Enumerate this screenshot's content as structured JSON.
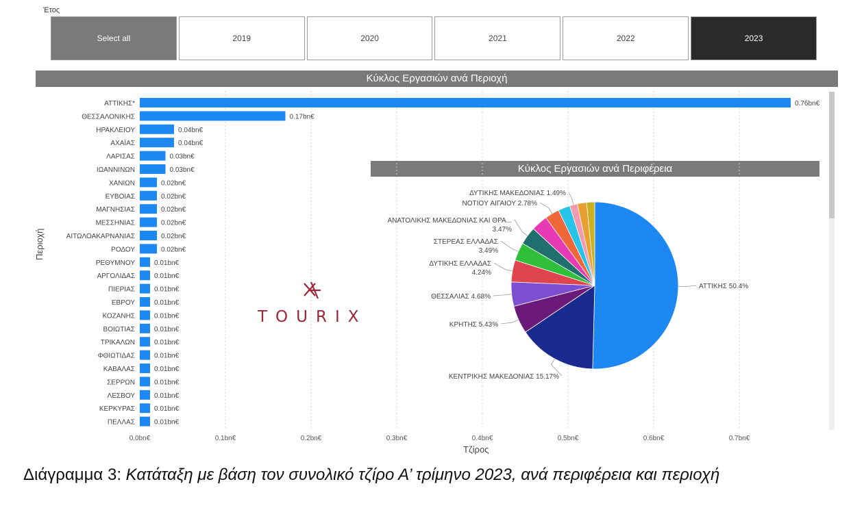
{
  "slicer": {
    "label": "Έτος",
    "buttons": [
      "Select all",
      "2019",
      "2020",
      "2021",
      "2022",
      "2023"
    ],
    "selected": "2023"
  },
  "logo": {
    "text": "TOURIX",
    "color": "#9b2738"
  },
  "caption": {
    "prefix": "Διάγραμμα 3: ",
    "text": "Κατάταξη με βάση τον συνολικό τζίρο Α’ τρίμηνο 2023, ανά περιφέρεια και περιοχή"
  },
  "chart_data": [
    {
      "type": "bar",
      "orientation": "horizontal",
      "title": "Κύκλος Εργασιών ανά Περιοχή",
      "xlabel": "Τζίρος",
      "ylabel": "Περιοχή",
      "xlim": [
        0,
        0.75
      ],
      "grid": true,
      "color": "#1e88f2",
      "xticks": [
        "0.0bn€",
        "0.1bn€",
        "0.2bn€",
        "0.3bn€",
        "0.4bn€",
        "0.5bn€",
        "0.6bn€",
        "0.7bn€"
      ],
      "xtick_values": [
        0,
        0.1,
        0.2,
        0.3,
        0.4,
        0.5,
        0.6,
        0.7
      ],
      "categories": [
        "ΑΤΤΙΚΗΣ*",
        "ΘΕΣΣΑΛΟΝΙΚΗΣ",
        "ΗΡΑΚΛΕΙΟΥ",
        "ΑΧΑΪΑΣ",
        "ΛΑΡΙΣΑΣ",
        "ΙΩΑΝΝΙΝΩΝ",
        "ΧΑΝΙΩΝ",
        "ΕΥΒΟΙΑΣ",
        "ΜΑΓΝΗΣΙΑΣ",
        "ΜΕΣΣΗΝΙΑΣ",
        "ΑΙΤΩΛΟΑΚΑΡΝΑΝΙΑΣ",
        "ΡΟΔΟΥ",
        "ΡΕΘΥΜΝΟΥ",
        "ΑΡΓΟΛΙΔΑΣ",
        "ΠΙΕΡΙΑΣ",
        "ΕΒΡΟΥ",
        "ΚΟΖΑΝΗΣ",
        "ΒΟΙΩΤΙΑΣ",
        "ΤΡΙΚΑΛΩΝ",
        "ΦΘΙΩΤΙΔΑΣ",
        "ΚΑΒΑΛΑΣ",
        "ΣΕΡΡΩΝ",
        "ΛΕΣΒΟΥ",
        "ΚΕΡΚΥΡΑΣ",
        "ΠΕΛΛΑΣ"
      ],
      "values": [
        0.76,
        0.17,
        0.04,
        0.04,
        0.03,
        0.03,
        0.02,
        0.02,
        0.02,
        0.02,
        0.02,
        0.02,
        0.01,
        0.01,
        0.01,
        0.01,
        0.01,
        0.01,
        0.01,
        0.01,
        0.01,
        0.01,
        0.01,
        0.01,
        0.01
      ],
      "data_labels": [
        "0.76bn€",
        "0.17bn€",
        "0.04bn€",
        "0.04bn€",
        "0.03bn€",
        "0.03bn€",
        "0.02bn€",
        "0.02bn€",
        "0.02bn€",
        "0.02bn€",
        "0.02bn€",
        "0.02bn€",
        "0.01bn€",
        "0.01bn€",
        "0.01bn€",
        "0.01bn€",
        "0.01bn€",
        "0.01bn€",
        "0.01bn€",
        "0.01bn€",
        "0.01bn€",
        "0.01bn€",
        "0.01bn€",
        "0.01bn€",
        "0.01bn€"
      ]
    },
    {
      "type": "pie",
      "title": "Κύκλος Εργασιών ανά Περιφέρεια",
      "slices": [
        {
          "label": "ΑΤΤΙΚΗΣ 50.4%",
          "value": 50.4,
          "color": "#1e88f2"
        },
        {
          "label": "ΚΕΝΤΡΙΚΗΣ ΜΑΚΕΔΟΝΙΑΣ 15.17%",
          "value": 15.17,
          "color": "#1a2a8f"
        },
        {
          "label": "ΚΡΗΤΗΣ 5.43%",
          "value": 5.43,
          "color": "#6b1a7a"
        },
        {
          "label": "ΘΕΣΣΑΛΙΑΣ 4.68%",
          "value": 4.68,
          "color": "#7b4fd0"
        },
        {
          "label": "ΔΥΤΙΚΗΣ ΕΛΛΑΔΑΣ 4.24%",
          "value": 4.24,
          "color": "#e0444f"
        },
        {
          "label": "ΣΤΕΡΕΑΣ ΕΛΛΑΔΑΣ 3.49%",
          "value": 3.49,
          "color": "#2fbf3a"
        },
        {
          "label": "ΑΝΑΤΟΛΙΚΗΣ ΜΑΚΕΔΟΝΙΑΣ ΚΑΙ ΘΡΑ... 3.47%",
          "value": 3.47,
          "color": "#1f6f6f"
        },
        {
          "label": "",
          "value": 3.2,
          "color": "#e83ab2"
        },
        {
          "label": "NOTIOY ΑΙΓΑΙΟΥ 2.78%",
          "value": 2.78,
          "color": "#f0683a"
        },
        {
          "label": "",
          "value": 2.3,
          "color": "#27c3e8"
        },
        {
          "label": "ΔΥΤΙΚΗΣ ΜΑΚΕΔΟΝΙΑΣ 1.49%",
          "value": 1.49,
          "color": "#f29ab0"
        },
        {
          "label": "",
          "value": 1.8,
          "color": "#e8a030"
        },
        {
          "label": "",
          "value": 1.55,
          "color": "#c8b020"
        }
      ]
    }
  ]
}
